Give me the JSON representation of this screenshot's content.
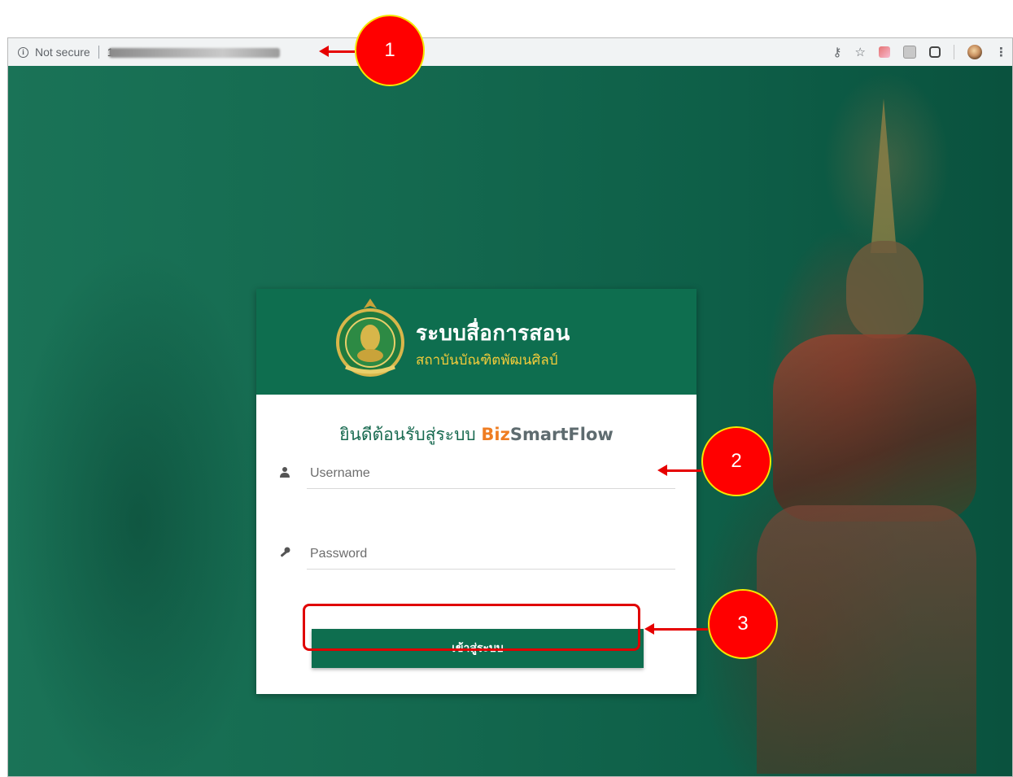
{
  "browser": {
    "security_label": "Not secure",
    "url_prefix": "1"
  },
  "card": {
    "brand_title": "ระบบสื่อการสอน",
    "brand_subtitle": "สถาบันบัณฑิตพัฒนศิลป์",
    "welcome_prefix": "ยินดีต้อนรับสู่ระบบ ",
    "welcome_biz": "Biz",
    "welcome_smartflow": "SmartFlow",
    "username_placeholder": "Username",
    "password_placeholder": "Password",
    "login_button": "เข้าสู่ระบบ"
  },
  "callouts": {
    "one": "1",
    "two": "2",
    "three": "3"
  },
  "colors": {
    "brand_green": "#0e6e4f",
    "biz_orange": "#ef7d22",
    "callout_red": "#ff0000",
    "callout_border": "#f5e600"
  }
}
